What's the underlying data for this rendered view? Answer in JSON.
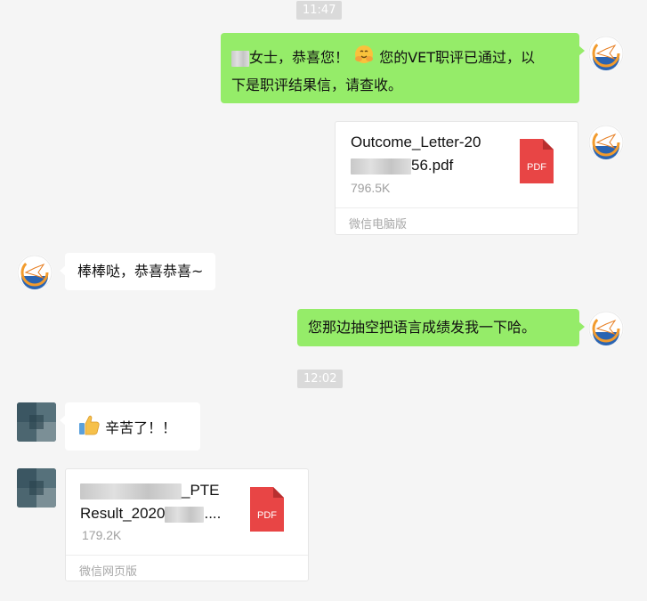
{
  "timestamps": [
    "11:47",
    "12:02"
  ],
  "messages": {
    "m1": {
      "prefix": "女士，恭喜您！",
      "rest": "您的VET职评已通过，以",
      "line2": "下是职评结果信，请查收。",
      "emoji": "hug-emoji"
    },
    "m2": {
      "name_line1": "Outcome_Letter-20",
      "name_line2_tail": "56.pdf",
      "size": "796.5K",
      "source": "微信电脑版",
      "icon_label": "PDF"
    },
    "m3": {
      "text": "棒棒哒，恭喜恭喜~"
    },
    "m4": {
      "text": "您那边抽空把语言成绩发我一下哈。"
    },
    "m5": {
      "text": "辛苦了！！",
      "emoji": "thumbs-up-emoji"
    },
    "m6": {
      "name_line1_tail": "_PTE",
      "name_line2_head": "Result_2020",
      "name_line2_tail": "....",
      "size": "179.2K",
      "source": "微信网页版",
      "icon_label": "PDF"
    }
  },
  "colors": {
    "sent_bubble": "#95ec69",
    "received_bubble": "#ffffff",
    "background": "#f5f5f5",
    "pdf_red": "#e84545"
  },
  "icons": {
    "agent_avatar": "bird-logo-avatar",
    "client_avatar": "mosaic-avatar"
  }
}
